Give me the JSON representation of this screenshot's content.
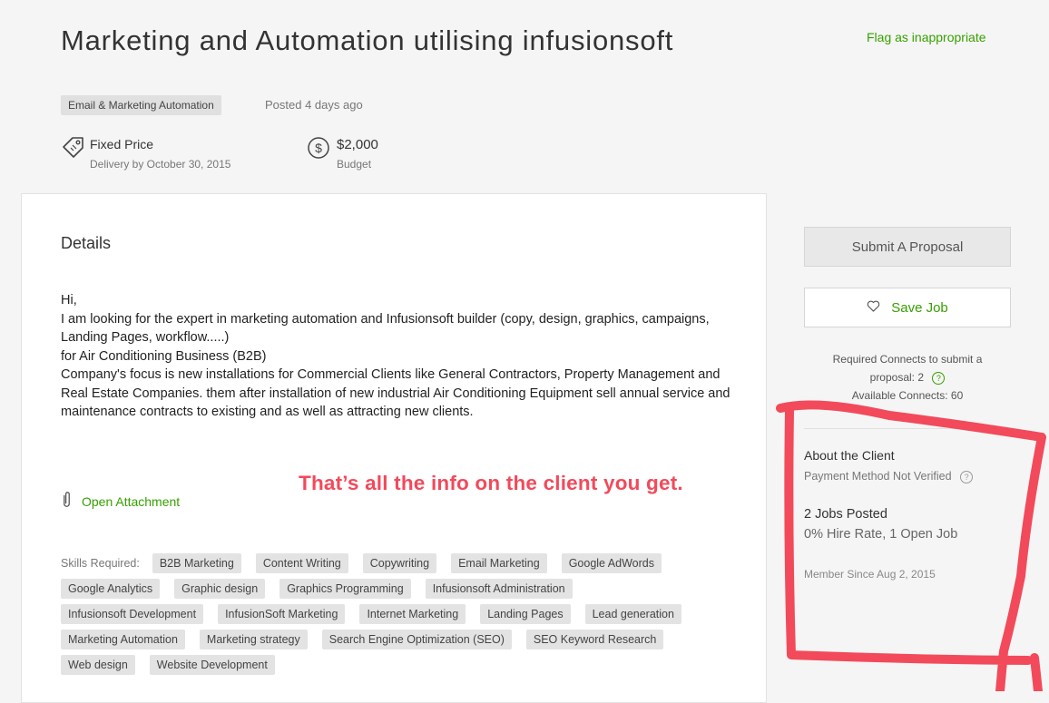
{
  "job": {
    "title": "Marketing and Automation utilising infusionsoft",
    "flag_label": "Flag as inappropriate",
    "category": "Email & Marketing Automation",
    "posted": "Posted 4 days ago",
    "pricing_type": "Fixed Price",
    "delivery": "Delivery by October 30, 2015",
    "budget_amount": "$2,000",
    "budget_label": "Budget"
  },
  "details": {
    "heading": "Details",
    "description": "Hi,\nI am looking for the expert in marketing automation and Infusionsoft builder (copy, design, graphics, campaigns, Landing Pages, workflow.....)\nfor Air Conditioning Business (B2B)\nCompany's focus is new installations for Commercial Clients like General Contractors, Property Management and Real Estate Companies. them after installation of new industrial Air Conditioning Equipment sell  annual service and maintenance contracts to existing and as well as attracting new clients.",
    "attachment_label": "Open Attachment",
    "skills_label": "Skills Required:",
    "skills": [
      "B2B Marketing",
      "Content Writing",
      "Copywriting",
      "Email Marketing",
      "Google AdWords",
      "Google Analytics",
      "Graphic design",
      "Graphics Programming",
      "Infusionsoft Administration",
      "Infusionsoft Development",
      "InfusionSoft Marketing",
      "Internet Marketing",
      "Landing Pages",
      "Lead generation",
      "Marketing Automation",
      "Marketing strategy",
      "Search Engine Optimization (SEO)",
      "SEO Keyword Research",
      "Web design",
      "Website Development"
    ]
  },
  "sidebar": {
    "submit_label": "Submit A Proposal",
    "save_label": "Save Job",
    "connects_line1": "Required Connects to submit a",
    "connects_line2": "proposal: 2",
    "connects_available": "Available Connects: 60",
    "help_glyph": "?"
  },
  "client": {
    "heading": "About the Client",
    "payment": "Payment Method Not Verified",
    "jobs_posted": "2 Jobs Posted",
    "hire_info": "0% Hire Rate, 1 Open Job",
    "member_since": "Member Since Aug 2, 2015"
  },
  "annotation": {
    "text": "That’s all the info on the client you get.",
    "color": "#f24a5b"
  },
  "colors": {
    "accent_green": "#37a000",
    "background": "#f5f5f5"
  }
}
